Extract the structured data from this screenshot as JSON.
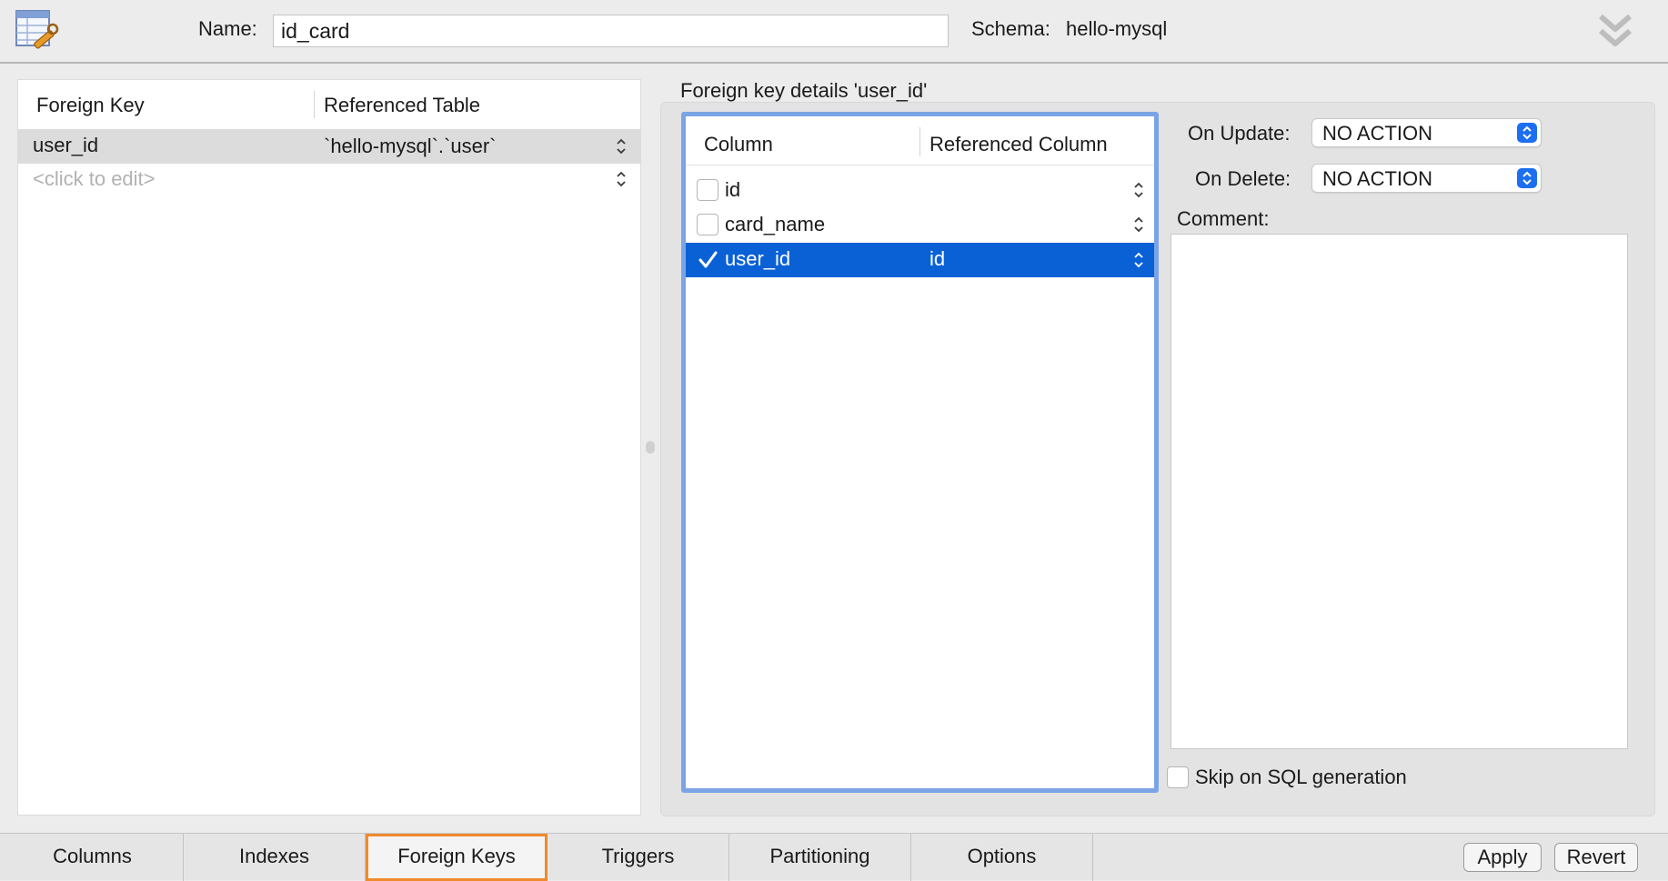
{
  "header": {
    "name_label": "Name:",
    "name_value": "id_card",
    "schema_label": "Schema:",
    "schema_value": "hello-mysql"
  },
  "fk_list": {
    "headers": [
      "Foreign Key",
      "Referenced Table"
    ],
    "rows": [
      {
        "fk": "user_id",
        "ref_table": "`hello-mysql`.`user`"
      }
    ],
    "placeholder": "<click to edit>"
  },
  "details": {
    "title": "Foreign key details 'user_id'",
    "table_headers": [
      "Column",
      "Referenced Column"
    ],
    "columns": [
      {
        "name": "id",
        "checked": false,
        "ref": ""
      },
      {
        "name": "card_name",
        "checked": false,
        "ref": ""
      },
      {
        "name": "user_id",
        "checked": true,
        "ref": "id"
      }
    ],
    "on_update_label": "On Update:",
    "on_update_value": "NO ACTION",
    "on_delete_label": "On Delete:",
    "on_delete_value": "NO ACTION",
    "comment_label": "Comment:",
    "skip_label": "Skip on SQL generation"
  },
  "tabs": [
    {
      "label": "Columns"
    },
    {
      "label": "Indexes"
    },
    {
      "label": "Foreign Keys",
      "active": true
    },
    {
      "label": "Triggers"
    },
    {
      "label": "Partitioning"
    },
    {
      "label": "Options"
    }
  ],
  "buttons": {
    "apply": "Apply",
    "revert": "Revert"
  },
  "colors": {
    "selection": "#0a61d6",
    "focus_ring": "#7aa4e6",
    "active_tab": "#ef8a2e",
    "select_btn": "#1b6ff0"
  }
}
